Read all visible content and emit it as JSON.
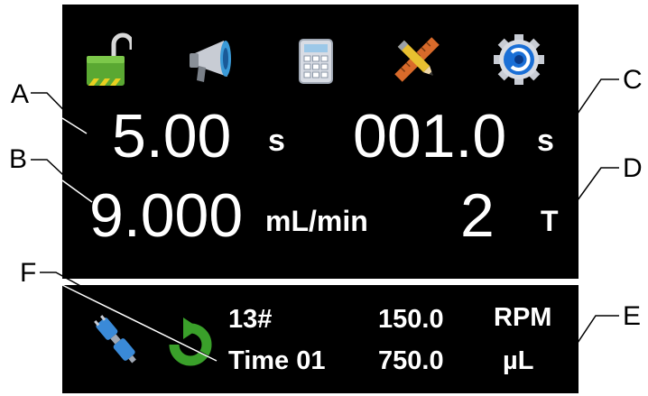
{
  "toolbar": {
    "icons": [
      "unlock-icon",
      "megaphone-icon",
      "calculator-icon",
      "pencil-ruler-icon",
      "gear-icon"
    ]
  },
  "main": {
    "time_value": "5.00",
    "time_unit": "s",
    "interval_value": "001.0",
    "interval_unit": "s",
    "flow_value": "9.000",
    "flow_unit": "mL/min",
    "count_value": "2",
    "count_unit": "T"
  },
  "status": {
    "line1_left": "13#",
    "line2_left": "Time 01",
    "line1_value": "150.0",
    "line1_unit": "RPM",
    "line2_value": "750.0",
    "line2_unit": "µL"
  },
  "callouts": {
    "a": "A",
    "b": "B",
    "c": "C",
    "d": "D",
    "e": "E",
    "f": "F"
  },
  "colors": {
    "background": "#000000",
    "text": "#ffffff",
    "lock_green": "#5aa832",
    "gear_blue": "#1a6fd6"
  }
}
